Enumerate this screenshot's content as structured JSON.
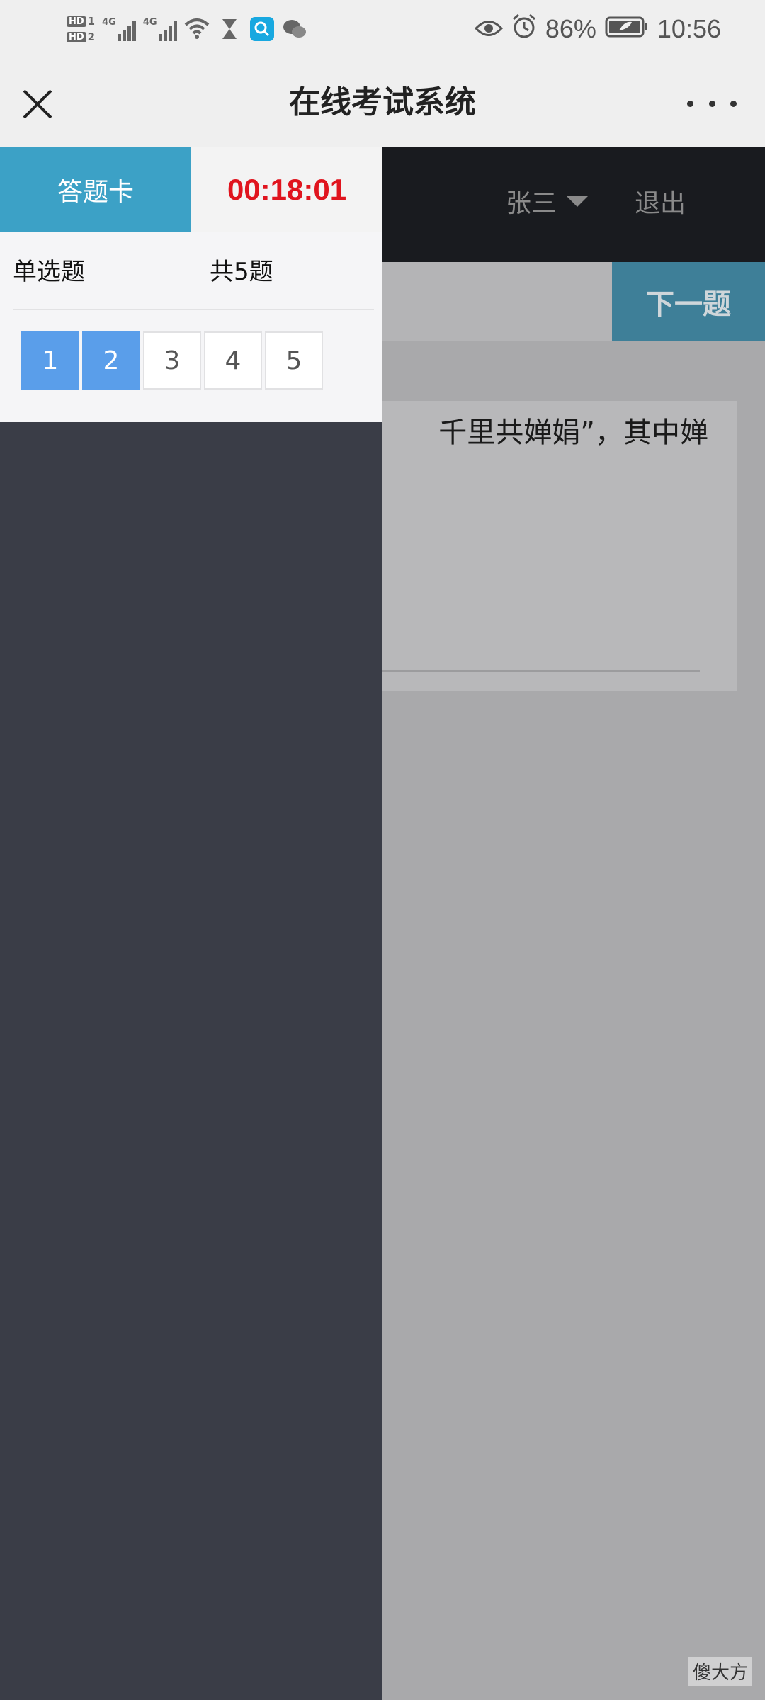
{
  "status_bar": {
    "sim1": "HD",
    "sim1_slot": "1",
    "sim2": "HD",
    "sim2_slot": "2",
    "network1": "4G",
    "network2": "4G",
    "battery": "86%",
    "time": "10:56",
    "icons": [
      "signal-icon",
      "wifi-icon",
      "hourglass-icon",
      "search-app-icon",
      "wechat-icon",
      "eye-icon",
      "alarm-icon",
      "battery-icon"
    ]
  },
  "title_bar": {
    "title": "在线考试系统",
    "close_icon": "close-icon",
    "more_icon": "more-icon"
  },
  "header": {
    "user_name": "张三",
    "logout": "退出"
  },
  "navigation": {
    "next_label": "下一题"
  },
  "question": {
    "text_fragment": "千里共婵娟”，其中婵"
  },
  "answer_card": {
    "tab_label": "答题卡",
    "timer": "00:18:01",
    "section_label": "单选题",
    "section_count": "共5题",
    "questions": [
      {
        "number": "1",
        "answered": true
      },
      {
        "number": "2",
        "answered": true
      },
      {
        "number": "3",
        "answered": false
      },
      {
        "number": "4",
        "answered": false
      },
      {
        "number": "5",
        "answered": false
      }
    ]
  },
  "watermark": "傻大方",
  "colors": {
    "accent": "#3ca1c6",
    "timer": "#e0141e",
    "answered": "#5a9eea",
    "nav_bg": "#191b1f",
    "drawer_bg": "#3a3d47"
  }
}
